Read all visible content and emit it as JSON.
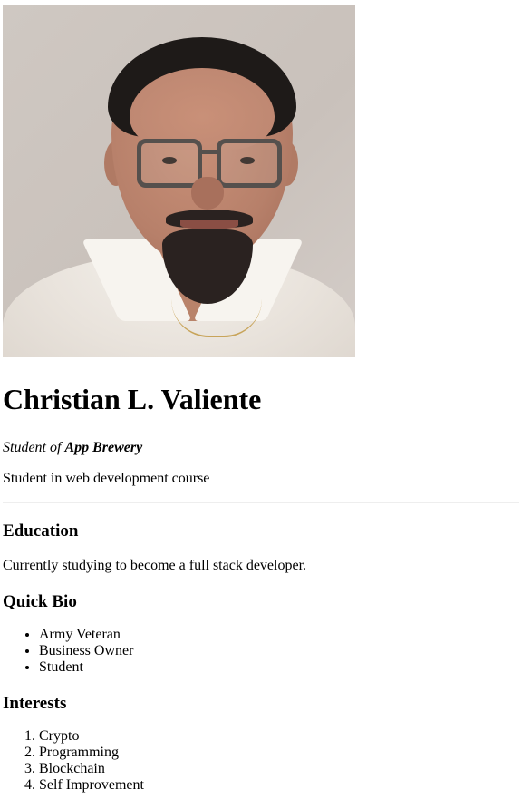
{
  "profile": {
    "photo_alt": "Profile photo of Christian L. Valiente",
    "name": "Christian L. Valiente",
    "subtitle_prefix": "Student of ",
    "subtitle_school": "App Brewery",
    "description": "Student in web development course"
  },
  "education": {
    "heading": "Education",
    "text": "Currently studying to become a full stack developer."
  },
  "bio": {
    "heading": "Quick Bio",
    "items": [
      "Army Veteran",
      "Business Owner",
      "Student"
    ]
  },
  "interests": {
    "heading": "Interests",
    "items": [
      "Crypto",
      "Programming",
      "Blockchain",
      "Self Improvement"
    ]
  }
}
